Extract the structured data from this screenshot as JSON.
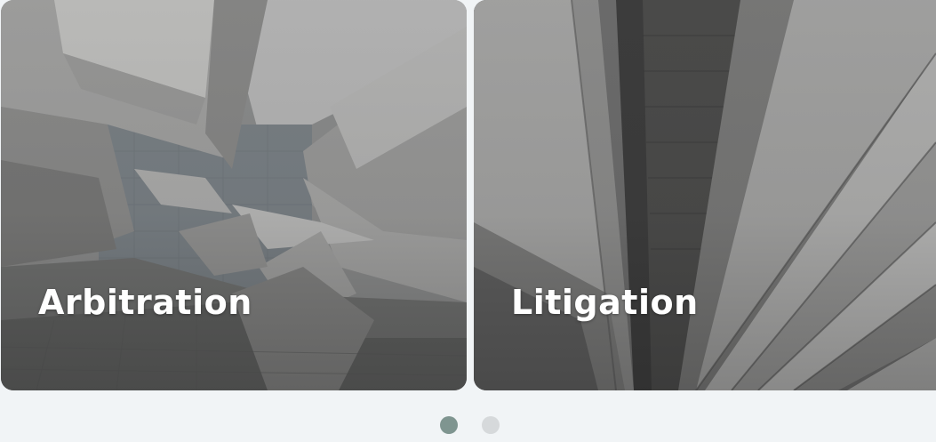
{
  "cards": [
    {
      "title": "Arbitration"
    },
    {
      "title": "Litigation"
    }
  ],
  "pagination": {
    "count": 2,
    "active_index": 0,
    "active_color": "#7f9590",
    "inactive_color": "#d6d9db"
  },
  "colors": {
    "page_background": "#f1f4f6",
    "card_title": "#ffffff"
  }
}
